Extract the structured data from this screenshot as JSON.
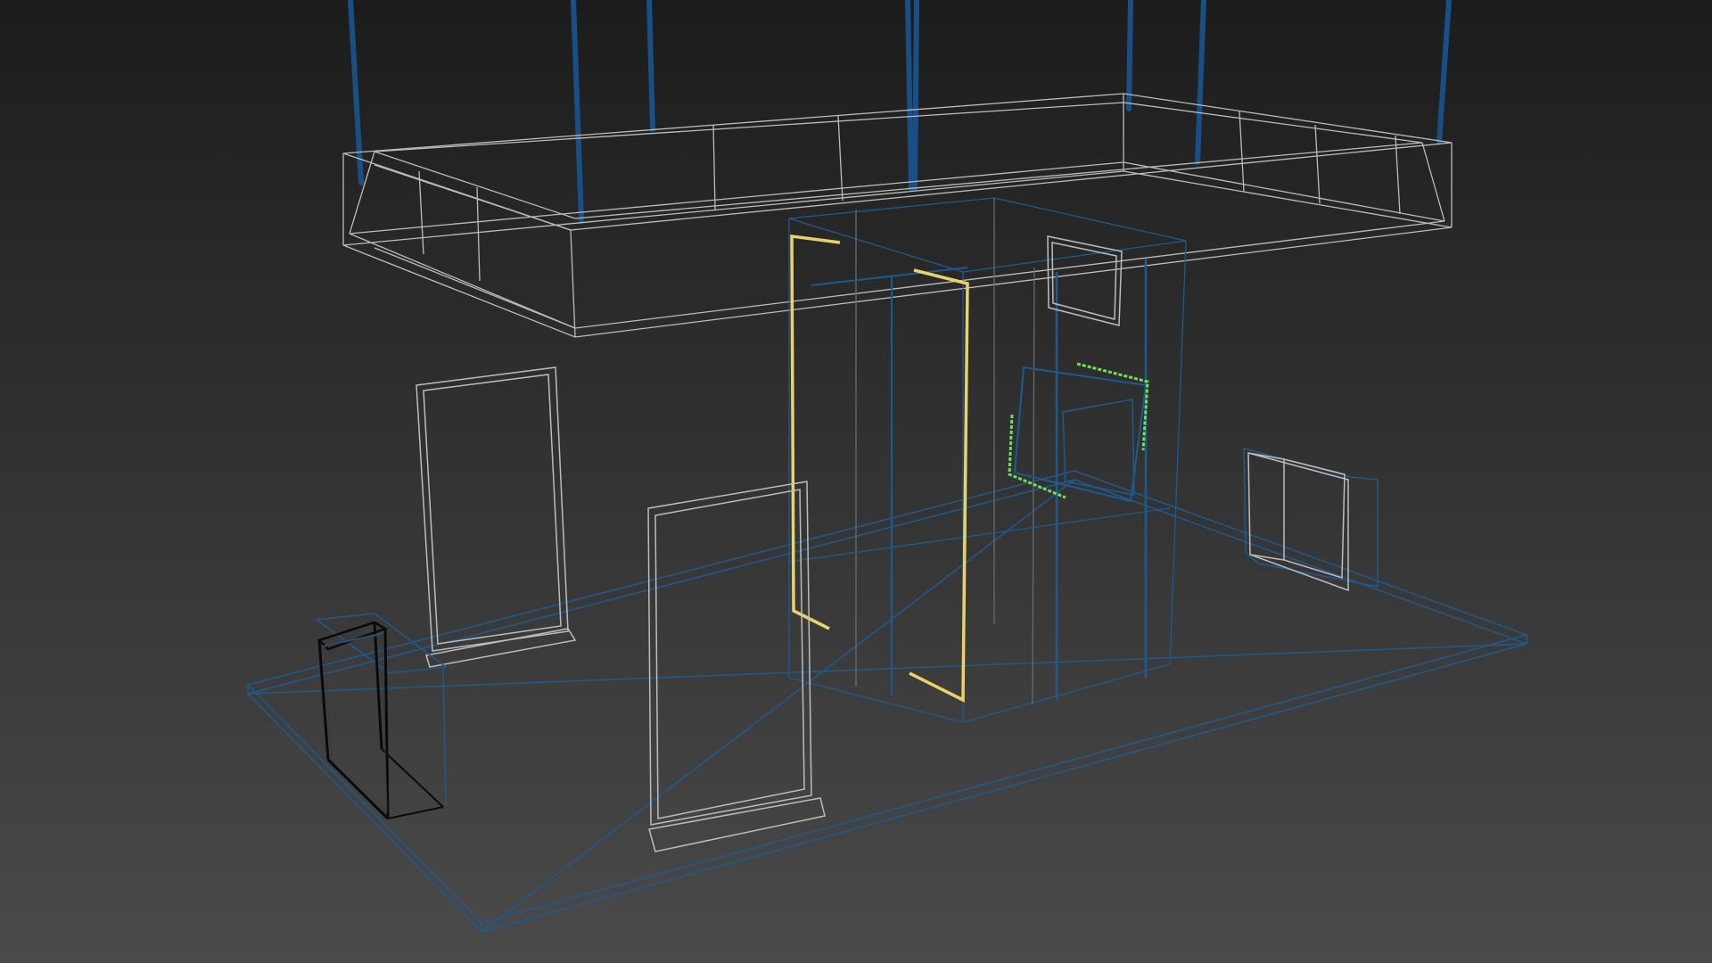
{
  "viewport": {
    "mode": "wireframe",
    "background_top": "#1c1c1c",
    "background_bottom": "#4a4a4a"
  },
  "colors": {
    "structure_edges": "#bcbcbc",
    "ground_edges": "#1e5a8c",
    "hanging_rods": "#1a4f86",
    "selection_outline": "#e8d36a",
    "display_screen": "#6fe05a",
    "selected_object": "#0a0a0a"
  },
  "objects": [
    "hanging-rod",
    "ceiling-frame",
    "booth-wall",
    "door-frame",
    "wall-mounted-screen",
    "standing-banner-left",
    "standing-banner-center",
    "side-counter-selected",
    "wall-cabinet-right",
    "floor-platform"
  ]
}
